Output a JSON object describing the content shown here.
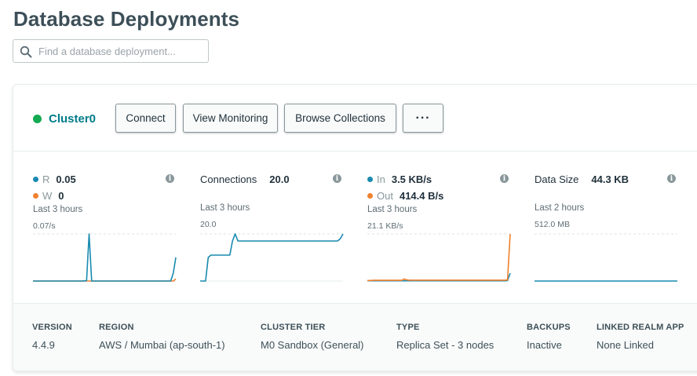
{
  "page": {
    "title": "Database Deployments",
    "search_placeholder": "Find a database deployment..."
  },
  "cluster": {
    "name": "Cluster0",
    "status_color": "#13aa52",
    "buttons": {
      "connect": "Connect",
      "view_monitoring": "View Monitoring",
      "browse_collections": "Browse Collections",
      "more": "···"
    }
  },
  "metrics": {
    "ops": {
      "r_label": "R",
      "r_value": "0.05",
      "w_label": "W",
      "w_value": "0",
      "timeframe": "Last 3 hours",
      "peak_label": "0.07/s",
      "r_series": [
        0,
        0,
        0,
        0,
        0,
        0,
        0,
        0,
        0,
        0,
        0,
        0,
        0,
        0,
        0,
        0,
        0,
        0,
        0,
        0,
        0.0002,
        0.0005,
        0.07,
        0,
        0,
        0,
        0,
        0,
        0,
        0,
        0,
        0,
        0,
        0,
        0,
        0,
        0,
        0,
        0,
        0,
        0,
        0,
        0,
        0,
        0,
        0,
        0,
        0,
        0,
        0,
        0,
        0,
        0,
        0,
        0,
        0.012,
        0.035
      ],
      "w_series": [
        0,
        0,
        0,
        0,
        0,
        0,
        0,
        0,
        0,
        0,
        0,
        0,
        0,
        0,
        0,
        0,
        0,
        0,
        0,
        0,
        0,
        0,
        0,
        0,
        0,
        0,
        0,
        0,
        0,
        0,
        0,
        0,
        0,
        0,
        0,
        0,
        0,
        0,
        0,
        0,
        0,
        0,
        0,
        0,
        0,
        0,
        0,
        0,
        0,
        0,
        0,
        0,
        0,
        0,
        0,
        0,
        0.003
      ],
      "max": 0.07
    },
    "connections": {
      "title": "Connections",
      "value": "20.0",
      "timeframe": "Last 3 hours",
      "peak_label": "20.0",
      "series": [
        0,
        0,
        0,
        10,
        11,
        11,
        11,
        11,
        11,
        11,
        11,
        11,
        17,
        20,
        17,
        17,
        17,
        17,
        17,
        17,
        17,
        17,
        17,
        17,
        17,
        17,
        17,
        17,
        17,
        17,
        17,
        17,
        17,
        17,
        17,
        17,
        17,
        17,
        17,
        17,
        17,
        17,
        17,
        17,
        17,
        17,
        17,
        17,
        17,
        17,
        17,
        17,
        18,
        20
      ],
      "max": 20
    },
    "network": {
      "in_label": "In",
      "in_value": "3.5 KB/s",
      "out_label": "Out",
      "out_value": "414.4 B/s",
      "timeframe": "Last 3 hours",
      "peak_label": "21.1 KB/s",
      "in_series": [
        0.1,
        0.1,
        0.1,
        0.1,
        0.1,
        0.1,
        0.1,
        0.1,
        0.1,
        0.1,
        0.1,
        0.1,
        0.1,
        0.1,
        0.1,
        0.1,
        0.1,
        0.1,
        0.1,
        0.1,
        0.1,
        0.1,
        0.1,
        0.1,
        0.1,
        0.1,
        0.1,
        0.1,
        0.1,
        0.1,
        0.1,
        0.1,
        0.1,
        0.1,
        0.1,
        0.1,
        0.1,
        0.1,
        0.1,
        0.1,
        0.1,
        0.1,
        0.1,
        0.1,
        0.1,
        0.1,
        0.1,
        0.1,
        0.1,
        0.1,
        0.1,
        0.1,
        0.1,
        0.2,
        3.5
      ],
      "out_series": [
        0.2,
        0.2,
        0.3,
        0.3,
        0.3,
        0.3,
        0.3,
        0.3,
        0.3,
        0.3,
        0.3,
        0.3,
        0.3,
        0.3,
        0.9,
        0.5,
        0.4,
        0.4,
        0.4,
        0.4,
        0.4,
        0.4,
        0.4,
        0.4,
        0.4,
        0.4,
        0.4,
        0.4,
        0.4,
        0.4,
        0.4,
        0.4,
        0.4,
        0.4,
        0.4,
        0.4,
        0.4,
        0.4,
        0.4,
        0.4,
        0.4,
        0.4,
        0.4,
        0.4,
        0.4,
        0.4,
        0.4,
        0.4,
        0.4,
        0.4,
        0.4,
        0.4,
        0.4,
        0.5,
        21.1
      ],
      "max": 21.1
    },
    "data_size": {
      "title": "Data Size",
      "value": "44.3 KB",
      "timeframe": "Last 2 hours",
      "peak_label": "512.0 MB",
      "series": [
        0.04,
        0.04,
        0.04,
        0.04,
        0.04,
        0.04,
        0.04,
        0.04,
        0.04,
        0.04
      ],
      "max": 512
    },
    "colors": {
      "primary": "#1a8ab0",
      "secondary": "#f0812f"
    }
  },
  "footer": {
    "version_label": "VERSION",
    "version_value": "4.4.9",
    "region_label": "REGION",
    "region_value": "AWS / Mumbai (ap-south-1)",
    "tier_label": "CLUSTER TIER",
    "tier_value": "M0 Sandbox (General)",
    "type_label": "TYPE",
    "type_value": "Replica Set - 3 nodes",
    "backups_label": "BACKUPS",
    "backups_value": "Inactive",
    "realm_label": "LINKED REALM APP",
    "realm_value": "None Linked"
  }
}
